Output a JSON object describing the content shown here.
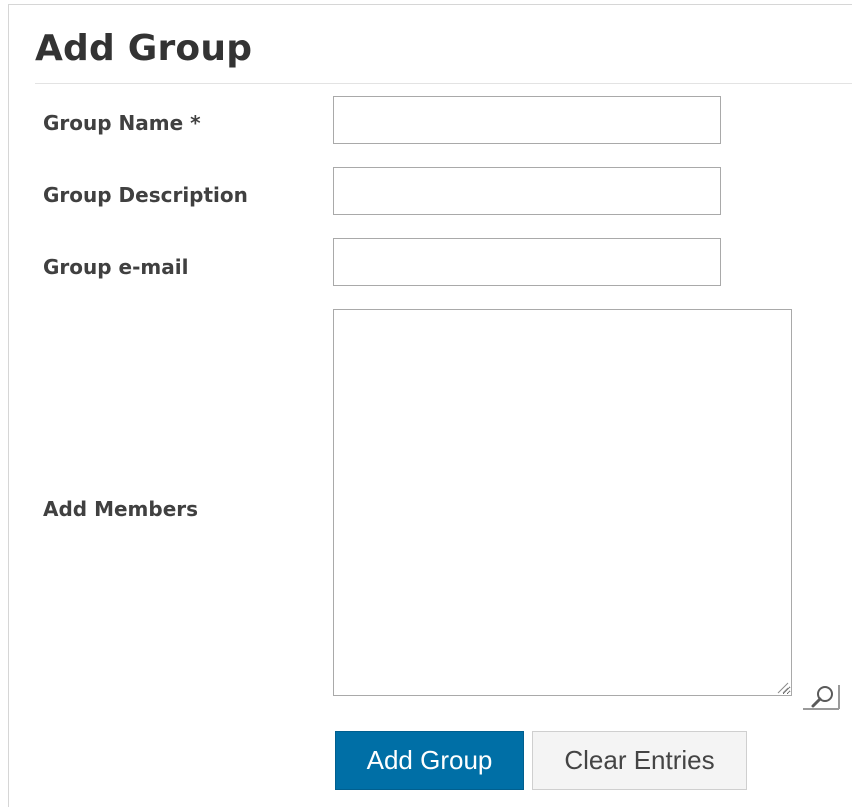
{
  "page": {
    "title": "Add Group"
  },
  "form": {
    "group_name": {
      "label": "Group Name *",
      "value": "",
      "placeholder": ""
    },
    "group_description": {
      "label": "Group Description",
      "value": "",
      "placeholder": ""
    },
    "group_email": {
      "label": "Group e-mail",
      "value": "",
      "placeholder": ""
    },
    "add_members": {
      "label": "Add Members",
      "value": "",
      "placeholder": ""
    }
  },
  "actions": {
    "add_group_label": "Add Group",
    "clear_entries_label": "Clear Entries"
  },
  "icons": {
    "lookup": "magnifier-icon",
    "resize": "resize-grip-icon"
  },
  "colors": {
    "primary_button": "#006fa6",
    "secondary_button": "#f4f4f4",
    "title_text": "#333333",
    "label_text": "#404040",
    "input_border": "#a9a9a9"
  }
}
